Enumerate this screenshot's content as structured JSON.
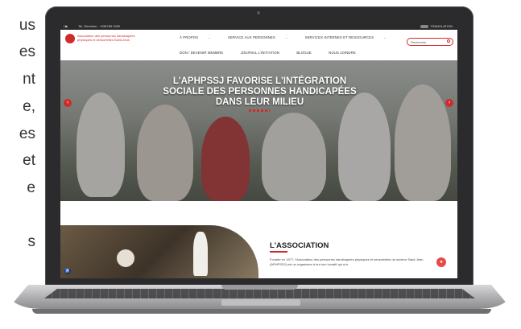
{
  "side_text": [
    "us",
    "es",
    "nt",
    "e,",
    "es",
    "et",
    "e",
    "s"
  ],
  "site": {
    "topbar": {
      "social": "f  ▶",
      "phone": "Tel. Direction : +336789 0320",
      "right_label": "TRANSLATION"
    },
    "brand": "Association des personnes handicapées physiques et sensorielles Saint-Jean",
    "nav": [
      {
        "label": "À PROPOS",
        "has_dropdown": true
      },
      {
        "label": "SERVICE AUX PERSONNES",
        "has_dropdown": true
      },
      {
        "label": "SERVICES INTERNES ET RESSOURCES",
        "has_dropdown": true
      },
      {
        "label": "DON / DEVENIR MEMBRE",
        "has_dropdown": false
      },
      {
        "label": "JOURNAL L'INITIATION",
        "has_dropdown": false
      },
      {
        "label": "BLOGUE",
        "has_dropdown": false
      },
      {
        "label": "NOUS JOINDRE",
        "has_dropdown": false
      }
    ],
    "search": {
      "placeholder": "Recherche"
    },
    "hero": {
      "title": "L'APHPSSJ FAVORISE L'INTÉGRATION SOCIALE DES PERSONNES HANDICAPÉES DANS LEUR MILIEU"
    },
    "section": {
      "title": "L'ASSOCIATION",
      "text": "Fondée en 1977, l'Association des personnes handicapées physiques et sensorielles du secteur Saint-Jean (APHPSSJ) est un organisme à but non lucratif qui a le"
    }
  },
  "colors": {
    "accent": "#d12a2a",
    "topbar": "#2a2a2a",
    "laptop": "#2b2b2d"
  }
}
